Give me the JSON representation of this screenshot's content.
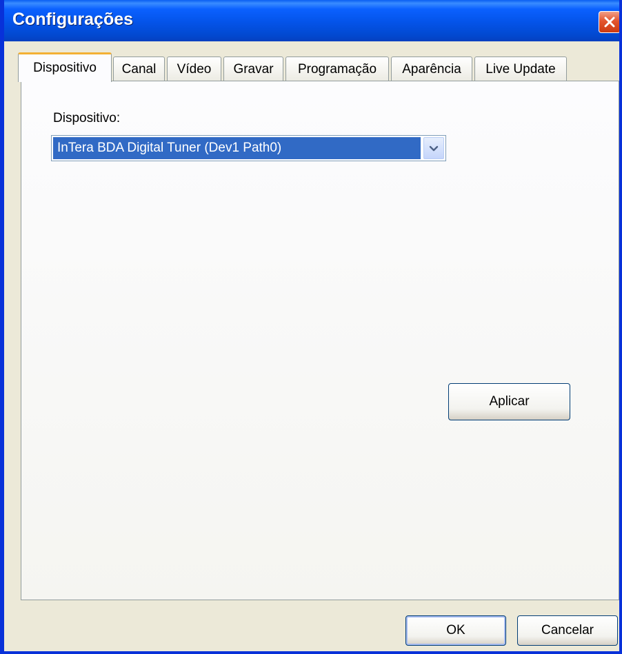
{
  "window": {
    "title": "Configurações"
  },
  "tabs": [
    {
      "label": "Dispositivo",
      "active": true
    },
    {
      "label": "Canal",
      "active": false
    },
    {
      "label": "Vídeo",
      "active": false
    },
    {
      "label": "Gravar",
      "active": false
    },
    {
      "label": "Programação",
      "active": false
    },
    {
      "label": "Aparência",
      "active": false
    },
    {
      "label": "Live Update",
      "active": false
    }
  ],
  "device_panel": {
    "label": "Dispositivo:",
    "device_select": {
      "selected": "InTera BDA Digital Tuner (Dev1 Path0)"
    },
    "apply_label": "Aplicar"
  },
  "footer": {
    "ok_label": "OK",
    "cancel_label": "Cancelar"
  },
  "colors": {
    "title_bar": "#0453e8",
    "active_tab_accent": "#f3b034",
    "selection": "#316ac5",
    "close_button": "#e3552e"
  },
  "icons": {
    "close": "close-icon",
    "dropdown": "chevron-down-icon"
  }
}
